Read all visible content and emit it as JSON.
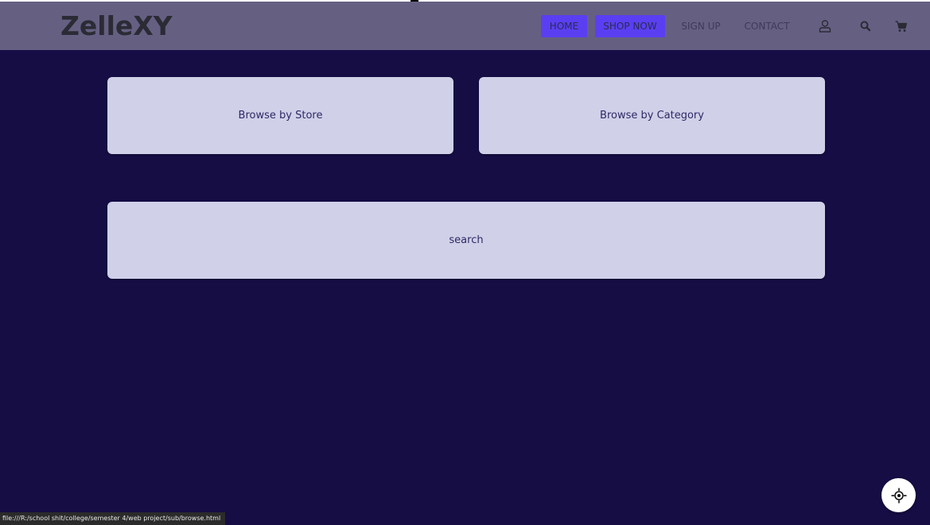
{
  "brand": {
    "logo_text": "ZelleXY"
  },
  "nav": {
    "items": [
      {
        "label": "HOME",
        "active": true
      },
      {
        "label": "SHOP NOW",
        "active": true
      },
      {
        "label": "SIGN UP",
        "active": false
      },
      {
        "label": "CONTACT",
        "active": false
      }
    ],
    "icons": [
      "user-icon",
      "search-icon",
      "cart-icon"
    ]
  },
  "main": {
    "browse_store_label": "Browse by Store",
    "browse_category_label": "Browse by Category",
    "search_label": "search"
  },
  "status_bar": {
    "url": "file:///R:/school shit/college/semester 4/web project/sub/browse.html"
  },
  "fab": {
    "icon": "locate-icon"
  },
  "colors": {
    "background": "#150d44",
    "navbar": "#656082",
    "accent": "#5a3ff2",
    "card": "#d0d0e8",
    "card_text": "#2e2a66",
    "logo": "#2b2b35"
  }
}
